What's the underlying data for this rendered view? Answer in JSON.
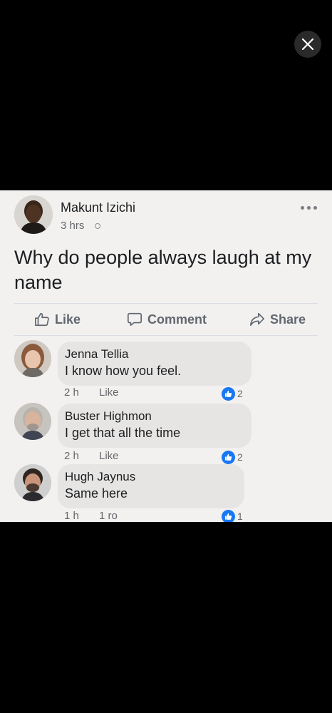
{
  "post": {
    "author": "Makunt Izichi",
    "time": "3 hrs",
    "text": "Why do people always laugh at my name",
    "actions": {
      "like": "Like",
      "comment": "Comment",
      "share": "Share"
    }
  },
  "comments": [
    {
      "name": "Jenna Tellia",
      "text": "I know how you feel.",
      "time": "2 h",
      "like": "Like",
      "reactions": "2"
    },
    {
      "name": "Buster Highmon",
      "text": "I get that all the time",
      "time": "2 h",
      "like": "Like",
      "reactions": "2"
    },
    {
      "name": "Hugh Jaynus",
      "text": "Same here",
      "time": "1 h",
      "like": "1 ro",
      "reactions": "1"
    }
  ],
  "colors": {
    "accent": "#1877f2",
    "background": "#000000",
    "card": "#f2f1ef",
    "bubble": "#e6e5e3"
  }
}
